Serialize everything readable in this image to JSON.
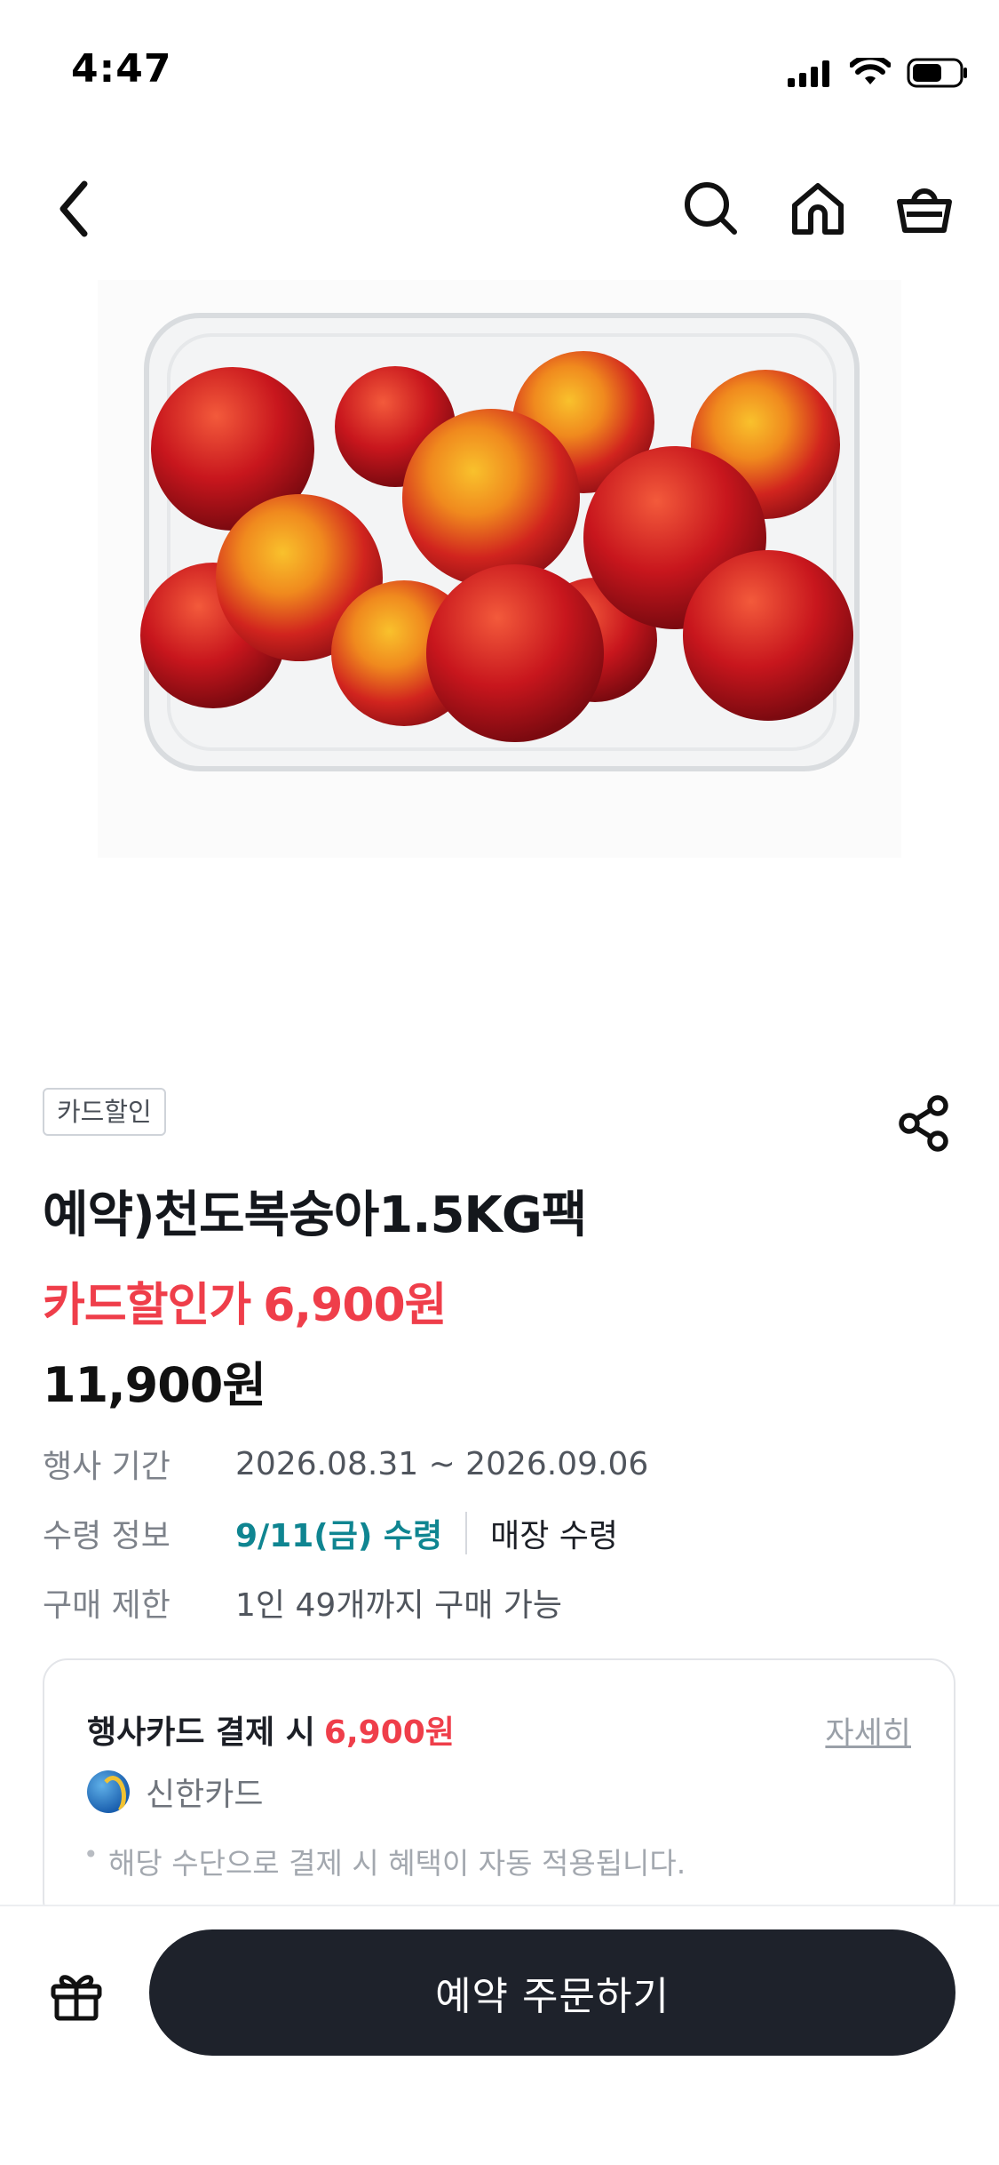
{
  "status_bar": {
    "time": "4:47"
  },
  "product": {
    "badge": "카드할인",
    "title": "예약)천도복숭아1.5KG팩",
    "card_price_label": "카드할인가",
    "card_price": "6,900원",
    "regular_price": "11,900원"
  },
  "info": {
    "event_period": {
      "label": "행사 기간",
      "value": "2026.08.31 ~ 2026.09.06"
    },
    "pickup": {
      "label": "수령 정보",
      "date": "9/11(금) 수령",
      "method": "매장 수령"
    },
    "limit": {
      "label": "구매 제한",
      "value": "1인 49개까지 구매 가능"
    }
  },
  "benefit": {
    "title_prefix": "행사카드 결제 시",
    "price": "6,900원",
    "more_link": "자세히",
    "card_name": "신한카드",
    "note": "해당 수단으로 결제 시 혜택이 자동 적용됩니다."
  },
  "bottom": {
    "order_button": "예약 주문하기"
  },
  "colors": {
    "accent_red": "#ef3e4a",
    "teal": "#0f8591",
    "button_dark": "#1e222b"
  },
  "icons": [
    "back-icon",
    "search-icon",
    "home-icon",
    "basket-icon",
    "share-icon",
    "gift-icon"
  ]
}
